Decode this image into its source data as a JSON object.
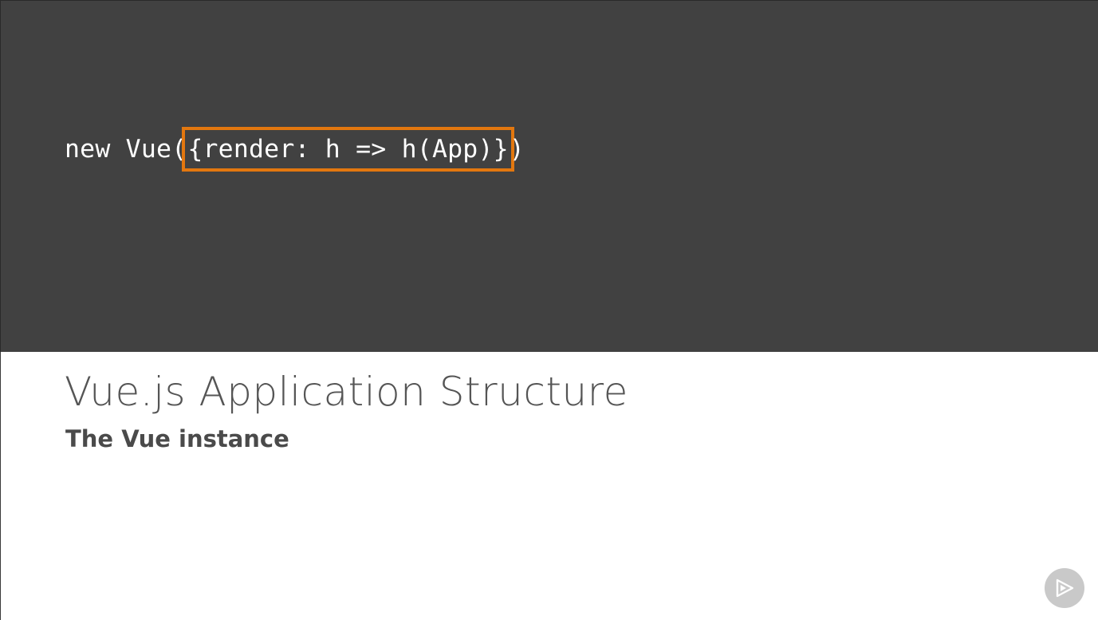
{
  "code": {
    "prefix": "new Vue(",
    "highlighted": "{render: h => h(App)}",
    "suffix": ")",
    "highlight_color": "#e2770f",
    "panel_color": "#414141"
  },
  "slide": {
    "title": "Vue.js Application Structure",
    "subtitle": "The Vue instance"
  },
  "controls": {
    "play_icon": "play-icon"
  }
}
